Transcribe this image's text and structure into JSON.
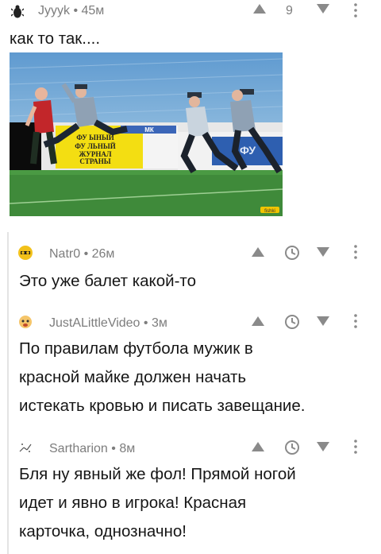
{
  "post": {
    "author": "Jyyyk",
    "time": "45м",
    "score": "9",
    "text": "как то так....",
    "image": {
      "banner_lines": [
        "ФУ   ЫНЫЙ",
        "ФУ   ЛЬНЫЙ",
        "ЖУРНАЛ",
        "СТРАНЫ"
      ],
      "banner2": "ФУ",
      "banner3": "МК",
      "watermark": "fishki"
    }
  },
  "comments": [
    {
      "author": "Natr0",
      "time": "26м",
      "text_lines": [
        "Это уже балет какой-то"
      ]
    },
    {
      "author": "JustALittleVideo",
      "time": "3м",
      "text_lines": [
        "По правилам футбола мужик в",
        "красной майке должен начать",
        "истекать кровью и писать завещание."
      ]
    },
    {
      "author": "Sartharion",
      "time": "8м",
      "text_lines": [
        "Бля ну явный же фол! Прямой ногой",
        "идет и явно в игрока! Красная",
        "карточка, однозначно!"
      ]
    }
  ],
  "colors": {
    "meta": "#7d7d7d",
    "icon": "#8a8a8a",
    "text": "#161616",
    "thread": "#e3e3e3"
  },
  "icons": [
    "bug-avatar-icon",
    "upvote-icon",
    "downvote-icon",
    "more-icon",
    "clock-icon"
  ]
}
